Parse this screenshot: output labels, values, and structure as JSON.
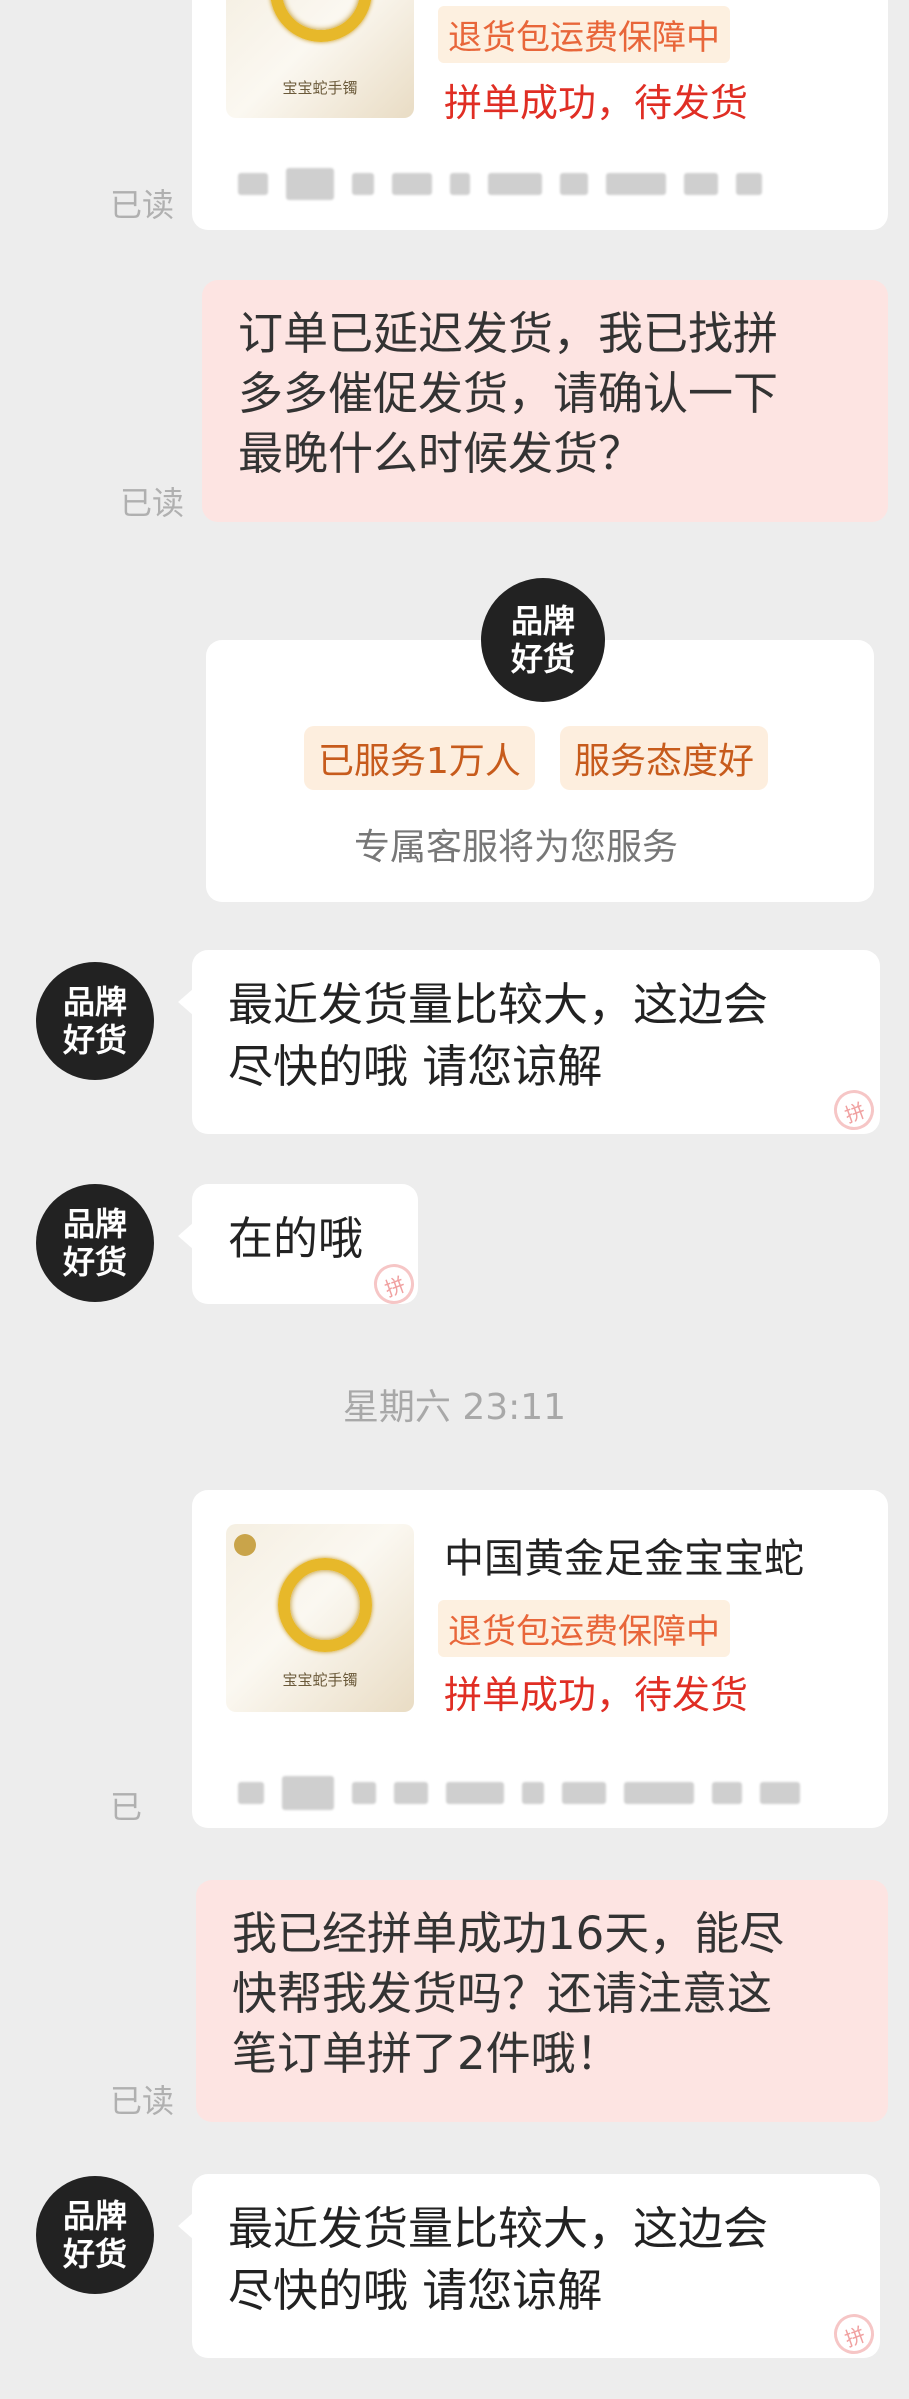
{
  "read_label": "已读",
  "read_label_partial": "已",
  "top_product": {
    "tag": "退货包运费保障中",
    "status": "拼单成功，待发货",
    "thumb_caption": "宝宝蛇手镯"
  },
  "msg1": {
    "lines": [
      "订单已延迟发货，我已找拼",
      "多多催促发货，请确认一下",
      "最晚什么时候发货？"
    ]
  },
  "brand_avatar": {
    "line1": "品牌",
    "line2": "好货"
  },
  "service_card": {
    "chip1": "已服务1万人",
    "chip2": "服务态度好",
    "subtitle": "专属客服将为您服务"
  },
  "reply1": {
    "lines": [
      "最近发货量比较大，这边会",
      "尽快的哦 请您谅解"
    ]
  },
  "reply2": {
    "text": "在的哦"
  },
  "timestamp": "星期六 23:11",
  "product2": {
    "title": "中国黄金足金宝宝蛇",
    "tag": "退货包运费保障中",
    "status": "拼单成功，待发货",
    "thumb_caption": "宝宝蛇手镯"
  },
  "msg2": {
    "lines": [
      "我已经拼单成功16天，能尽",
      "快帮我发货吗？还请注意这",
      "笔订单拼了2件哦！"
    ]
  },
  "reply3": {
    "lines": [
      "最近发货量比较大，这边会",
      "尽快的哦 请您谅解"
    ]
  },
  "watermark_char": "拼"
}
